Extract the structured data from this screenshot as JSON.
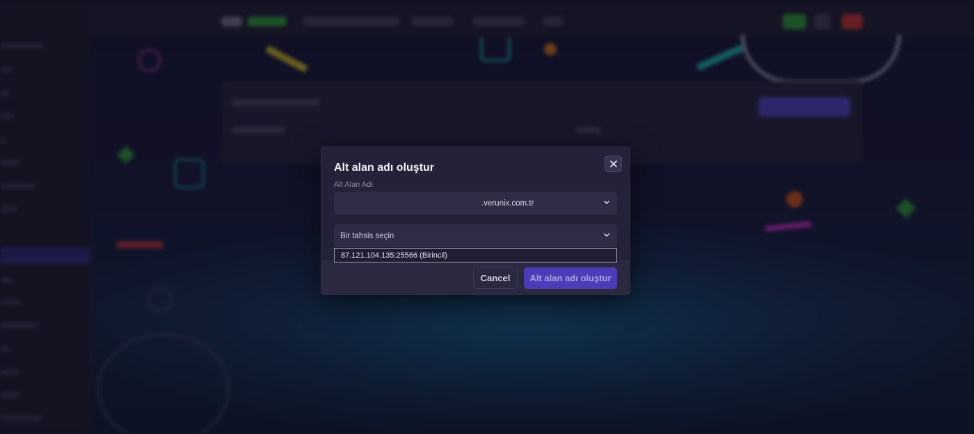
{
  "modal": {
    "title": "Alt alan adı oluştur",
    "subdomain_label": "Alt Alan Adı",
    "domain_suffix": ".verunix.com.tr",
    "allocation_placeholder": "Bir tahsis seçin",
    "allocation_options": [
      "87.121.104.135:25566 (Birincil)"
    ],
    "cancel_label": "Cancel",
    "submit_label": "Alt alan adı oluştur",
    "close_icon": "close-icon",
    "dropdown_icon": "chevron-down-icon"
  },
  "colors": {
    "primary_button": "#4b3db8",
    "modal_background": "#232238",
    "page_background": "#15152a"
  }
}
